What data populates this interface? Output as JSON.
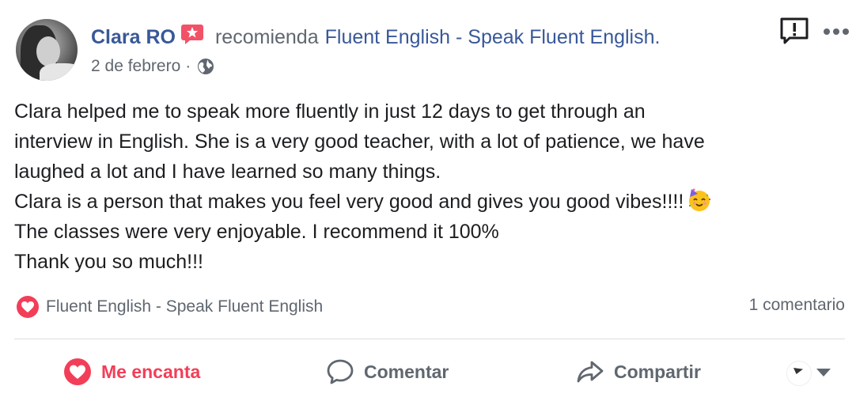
{
  "post": {
    "author": "Clara RO",
    "verb": "recomienda",
    "page_name": "Fluent English - Speak Fluent English.",
    "date": "2 de febrero",
    "separator": "·",
    "body_lines": [
      "Clara helped me to speak more fluently in just 12 days to get through an",
      "interview in English. She is a very good teacher, with a lot of patience, we have",
      "laughed a lot and I have learned so many things.",
      "Clara is a person that makes you feel very good and gives you good vibes!!!!",
      "The classes were very enjoyable. I recommend it 100%",
      "Thank you so much!!!"
    ],
    "emoji_icon": "partying-face-icon"
  },
  "reactions": {
    "reactor": "Fluent English - Speak Fluent English",
    "comments": "1 comentario"
  },
  "actions": {
    "love_label": "Me encanta",
    "comment_label": "Comentar",
    "share_label": "Compartir"
  },
  "colors": {
    "link": "#385898",
    "love": "#f33e58",
    "muted": "#606770",
    "text": "#1c1e21"
  }
}
